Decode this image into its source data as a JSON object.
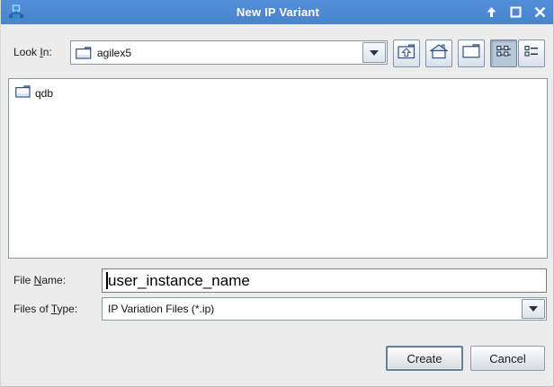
{
  "window": {
    "title": "New IP Variant",
    "icon": "hierarchy-icon",
    "controls": {
      "rollup": "roll-up",
      "maximize": "maximize",
      "close": "close"
    }
  },
  "look_in": {
    "label_pre": "Look ",
    "label_mnemonic": "I",
    "label_post": "n:",
    "value": "agilex5"
  },
  "toolbar": {
    "buttons": [
      {
        "name": "up-one-level",
        "icon": "folder-up-icon",
        "pressed": false
      },
      {
        "name": "home",
        "icon": "home-icon",
        "pressed": false
      },
      {
        "name": "create-new-folder",
        "icon": "new-folder-icon",
        "pressed": false
      },
      {
        "name": "list-view",
        "icon": "list-view-icon",
        "pressed": true
      },
      {
        "name": "details-view",
        "icon": "details-view-icon",
        "pressed": false
      }
    ]
  },
  "file_list": {
    "items": [
      {
        "name": "qdb",
        "type": "folder",
        "icon": "folder-icon"
      }
    ]
  },
  "file_name": {
    "label_pre": "File ",
    "label_mnemonic": "N",
    "label_post": "ame:",
    "value": "user_instance_name"
  },
  "files_of_type": {
    "label_pre": "Files of ",
    "label_mnemonic": "T",
    "label_post": "ype:",
    "value": "IP Variation Files (*.ip)"
  },
  "actions": {
    "create": "Create",
    "cancel": "Cancel"
  },
  "colors": {
    "titlebar": "#4d87d2",
    "folder_flap": "#6d93c9",
    "pressed_button_bg": "#b9c8d9",
    "field_border": "#8598aa"
  }
}
